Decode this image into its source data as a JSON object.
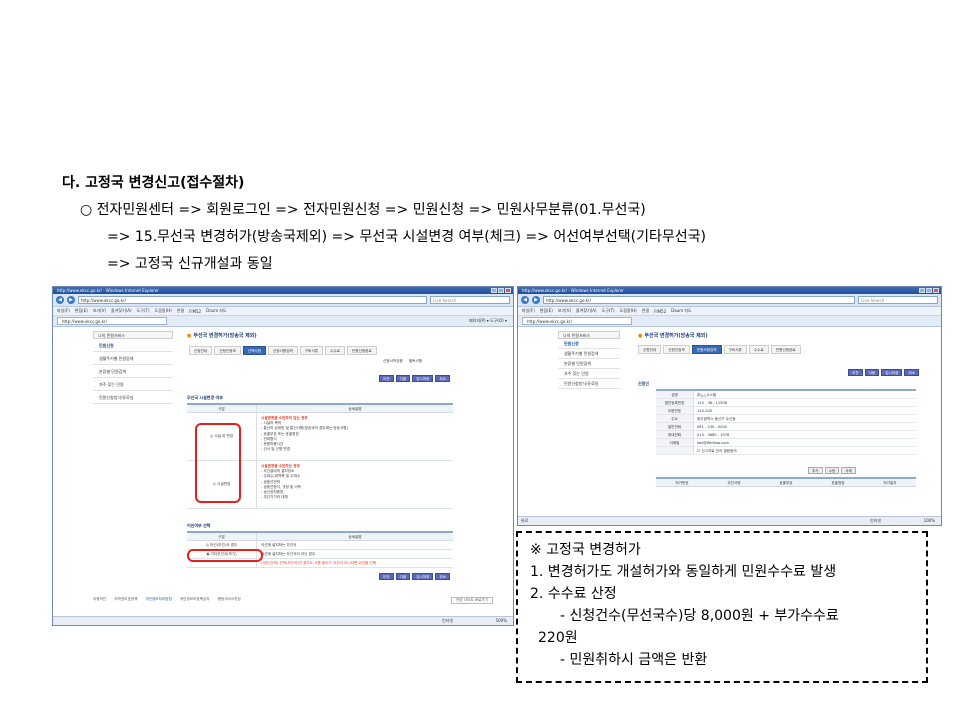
{
  "heading": "다. 고정국 변경신고(접수절차)",
  "description": [
    "○  전자민원센터 => 회원로그인 => 전자민원신청 => 민원신청 => 민원사무분류(01.무선국)",
    "=> 15.무선국 변경허가(방송국제외) => 무선국 시설변경 여부(체크) => 어선여부선택(기타무선국)",
    "=> 고정국 신규개설과 동일"
  ],
  "browser_left": {
    "window_title": "http://www.ekcc.go.kr/ - Windows Internet Explorer",
    "url": "http://www.ekcc.go.kr/",
    "search_placeholder": "Live Search",
    "menu": [
      "파일(F)",
      "편집(E)",
      "보기(V)",
      "즐겨찾기(A)",
      "도구(T)",
      "도움말(H)",
      "연결",
      "FIM52",
      "Daum 지도"
    ],
    "tab_url": "http://www.ekcc.go.kr/",
    "toolbar_right": "페이지(P) ▾  도구(O) ▾",
    "sidebar_head": "나의 민원서비스",
    "sidebar": [
      "민원신청",
      "생활주기별 민원검색",
      "분류별 민원검색",
      "자주 찾는 민원",
      "민원신청방식/유료실"
    ],
    "page_title": "무선국 변경허가(방송국 제외)",
    "tabs": [
      "신청안내",
      "신청인정보",
      "선택사항",
      "신청사항입력",
      "구비서류",
      "수수료",
      "민원신청완료"
    ],
    "links": [
      "신청서작성중",
      "필독사항"
    ],
    "buttons_top": [
      "이전",
      "다음",
      "임시저장",
      "취소"
    ],
    "section1": "무선국 시설변경 여부",
    "grid1_head": [
      "구분",
      "상세설명"
    ],
    "grid1_rows": [
      {
        "label": "◎ 시설 외 변경",
        "title": "시설변경을 수반하지 않는 경우",
        "lines": [
          "- 시설의 목적",
          "- 통신의 상대방 및 통신사항(방송국의 경우에는 방송사항)",
          "- 호출부호 또는 호출명칭",
          "- 전파형식",
          "- 운용허용시간",
          "- 선서 및 선명 변경"
        ]
      },
      {
        "label": "◎ 시설변경",
        "title": "시설변경을 수반하는 경우",
        "lines": [
          "- 무선설비의 설치장소",
          "- 주파수(대역폭 및 주파수",
          "- 공중선전력",
          "- 공중선형식, 규정 및 이득",
          "- 송신장치종류",
          "- 무선기기의 대체"
        ]
      }
    ],
    "section2": "어선여부 선택",
    "grid2_head": [
      "구분",
      "상세설명"
    ],
    "grid2_rows": [
      {
        "label": "◎ 어선(무선)국 경우",
        "text": "어선에 설치하는 무선국"
      },
      {
        "label": "◉ 기타무선국(보기)",
        "text": "어선에 설치하는 무선국이 아닌 경우"
      },
      {
        "label": "",
        "text": "(개인,단체) 선박(저구국)인 경우도 사용 용도가 어선이 아니라면 이것을 선택"
      }
    ],
    "buttons_bottom": [
      "이전",
      "다음",
      "임시저장",
      "취소"
    ],
    "footer": [
      "이용약관",
      "저작권보호정책",
      "개인정보처리방침",
      "개인정보보호책임자",
      "행정서비스헌장"
    ],
    "family_site": "관련 사이트 바로가기",
    "status_zone": "인터넷",
    "zoom": "100%"
  },
  "browser_right": {
    "window_title": "http://www.ekcc.go.kr/ - Windows Internet Explorer",
    "url": "http://www.ekcc.go.kr/",
    "search_placeholder": "Live Search",
    "sidebar_head": "나의 민원서비스",
    "sidebar": [
      "민원신청",
      "생활주기별 민원검색",
      "분류별 민원검색",
      "자주 찾는 민원",
      "민원신청방식/유료실"
    ],
    "page_title": "무선국 변경허가(방송국 제외)",
    "tabs": [
      "신청안내",
      "신청인정보",
      "민원사항입력",
      "구비서류",
      "수수료",
      "민원신청완료"
    ],
    "buttons_top": [
      "이전",
      "다음",
      "임시저장",
      "취소"
    ],
    "section": "신청인",
    "form": [
      {
        "label": "성명",
        "value": "㈜△△시스템"
      },
      {
        "label": "법인등록번호",
        "value": "110 - 38 - 11506"
      },
      {
        "label": "우편번호",
        "value": "120-200"
      },
      {
        "label": "주소",
        "value": "광주광역시 동산구 두산동"
      },
      {
        "label": "일반전화",
        "value": "061 - 230 - 0000"
      },
      {
        "label": "휴대전화",
        "value": "010 - 3685 - 1978"
      },
      {
        "label": "이메일",
        "value": "kes@Whtkoo.com"
      }
    ],
    "agree": "신고자료 전자 열람동의",
    "buttons_mid": [
      "추가",
      "수정",
      "삭제"
    ],
    "list_head": [
      "허가번호",
      "무선국명",
      "호출부호",
      "호출명칭",
      "허가일자"
    ],
    "status": "완료",
    "status_zone": "인터넷",
    "zoom": "100%"
  },
  "note": {
    "title": "※ 고정국 변경허가",
    "items": [
      "1.  변경허가도 개설허가와 동일하게 민원수수료 발생",
      "2.  수수료 산정"
    ],
    "sub": [
      "- 신청건수(무선국수)당 8,000원 + 부가수수료",
      "220원",
      "- 민원취하시 금액은 반환"
    ]
  }
}
